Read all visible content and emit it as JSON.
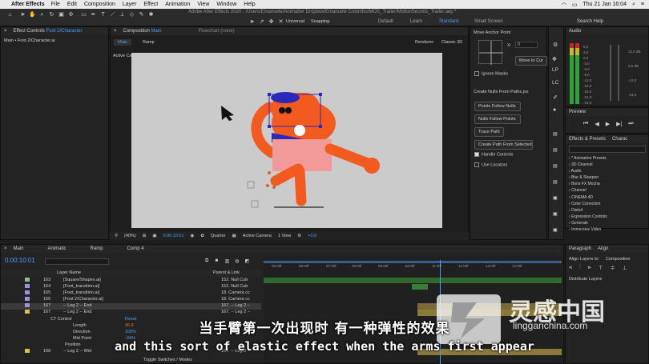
{
  "menubar": {
    "app": "After Effects",
    "items": [
      "File",
      "Edit",
      "Composition",
      "Layer",
      "Effect",
      "Animation",
      "View",
      "Window",
      "Help"
    ],
    "clock": "Thu 21 Jan 16:04"
  },
  "window": {
    "title": "Adobe After Effects 2020 - /Users/Emanuele/Animatter Dropbox/Emanuele Colombo/MOS_Trailer/MotionSecrets_Trailer.aep *"
  },
  "toolbar": {
    "universal": "Universal",
    "snapping": "Snapping",
    "workspaces": [
      "Default",
      "Learn",
      "Standard",
      "Small Screen"
    ],
    "search": "Search Help"
  },
  "effect_controls": {
    "tab": "Effect Controls",
    "tab_target": "Foot 2/Character",
    "subtitle": "Main • Foot 2/Character.ai"
  },
  "composition": {
    "tab": "Composition",
    "tab_target": "Main",
    "flowchart": "Flowchart (none)",
    "breadcrumbs": [
      "Main",
      "Ramp"
    ],
    "renderer_label": "Renderer:",
    "renderer": "Classic 3D",
    "active_camera_label": "Active Camera",
    "zoom": "(40%)",
    "timecode": "0:00:10:01",
    "quality": "Quarter",
    "camera": "Active Camera",
    "views": "1 View",
    "offset": "+0,0"
  },
  "move_anchor": {
    "title": "Move Anchor Point",
    "x_label": "X:",
    "x_value": "0",
    "button": "Move to Cur",
    "ignore_masks": "Ignore Masks"
  },
  "nulls": {
    "title": "Create Nulls From Paths.jsx",
    "buttons": [
      "Points Follow Nulls",
      "Nulls Follow Points",
      "Trace Path",
      "Create Path From Selected"
    ],
    "handle_controls": "Handle Controls",
    "use_locators": "Use Locators"
  },
  "right_tools": [
    "LP",
    "LC"
  ],
  "audio": {
    "tab": "Audio",
    "db_labels": [
      "6,0",
      "3,0",
      "0,0",
      "-3,0",
      "-6,0",
      "-9,0",
      "-12,0",
      "-15,0",
      "-18,0",
      "-21,0",
      "-24,0"
    ],
    "right_labels": [
      "12,0 dB",
      "0,0 dB",
      "-12,0",
      "-24,0"
    ]
  },
  "preview": {
    "tab": "Preview"
  },
  "effects_presets": {
    "tab": "Effects & Presets",
    "tab2": "Charac",
    "items": [
      "* Animation Presets",
      "3D Channel",
      "Audio",
      "Blur & Sharpen",
      "Boris FX Mocha",
      "Channel",
      "CINEMA 4D",
      "Color Correction",
      "Distort",
      "Expression Controls",
      "Generate",
      "Immersive Video"
    ]
  },
  "align": {
    "tabs": [
      "Paragraph",
      "Align"
    ],
    "label": "Align Layers to:",
    "target": "Composition",
    "distribute": "Distribute Layers"
  },
  "timeline": {
    "tabs": [
      "Main",
      "Animatic",
      "Ramp",
      "Comp 4"
    ],
    "timecode": "0:00:10:01",
    "ruler": [
      "06:00f",
      "06:00f",
      "07:00f",
      "08:00f",
      "09:00f",
      "10:00f",
      "11:00f",
      "12:00f",
      "13:00f",
      "14:00f"
    ],
    "header": {
      "layer_name": "Layer Name",
      "parent": "Parent & Link"
    },
    "layers": [
      {
        "num": "163",
        "name": "[Square/Shapes.ai]",
        "parent": "152. Null Cub",
        "color": "#8fbf8f"
      },
      {
        "num": "164",
        "name": "[Foot_transition.ai]",
        "parent": "152. Null Cub",
        "color": "#a58fd8"
      },
      {
        "num": "165",
        "name": "[Foot_transition.ai]",
        "parent": "18. Camera cc",
        "color": "#a58fd8"
      },
      {
        "num": "166",
        "name": "[Foot 2/Character.ai]",
        "parent": "18. Camera cc",
        "color": "#a58fd8"
      },
      {
        "num": "167",
        "name": "-- Leg 2 -- End",
        "parent": "167. -- Leg 2 --",
        "color": "#d8c24f"
      }
    ],
    "props": [
      {
        "name": "CT Control",
        "value": "Reset"
      },
      {
        "name": "Length",
        "value": "46,8"
      },
      {
        "name": "Direction",
        "value": "100%"
      },
      {
        "name": "Mid Point",
        "value": "-94%"
      },
      {
        "name": "Position",
        "value": ""
      }
    ],
    "last_layer": {
      "num": "168",
      "name": "-- Leg 2 -- Wid",
      "parent": "167. -- Leg 2 --"
    },
    "footer": "Toggle Switches / Modes"
  },
  "subtitles": {
    "cn": "当手臂第一次出现时 有一种弹性的效果",
    "en": "and this sort of elastic effect when the arms first appear"
  },
  "watermark": {
    "cn": "灵感中国",
    "en": "lingganchina.com"
  },
  "colors": {
    "accent": "#4d9cf5",
    "orange": "#f25a1f",
    "pink": "#f29a9a",
    "blue": "#2a2aba",
    "canvas": "#cbcbcb"
  }
}
